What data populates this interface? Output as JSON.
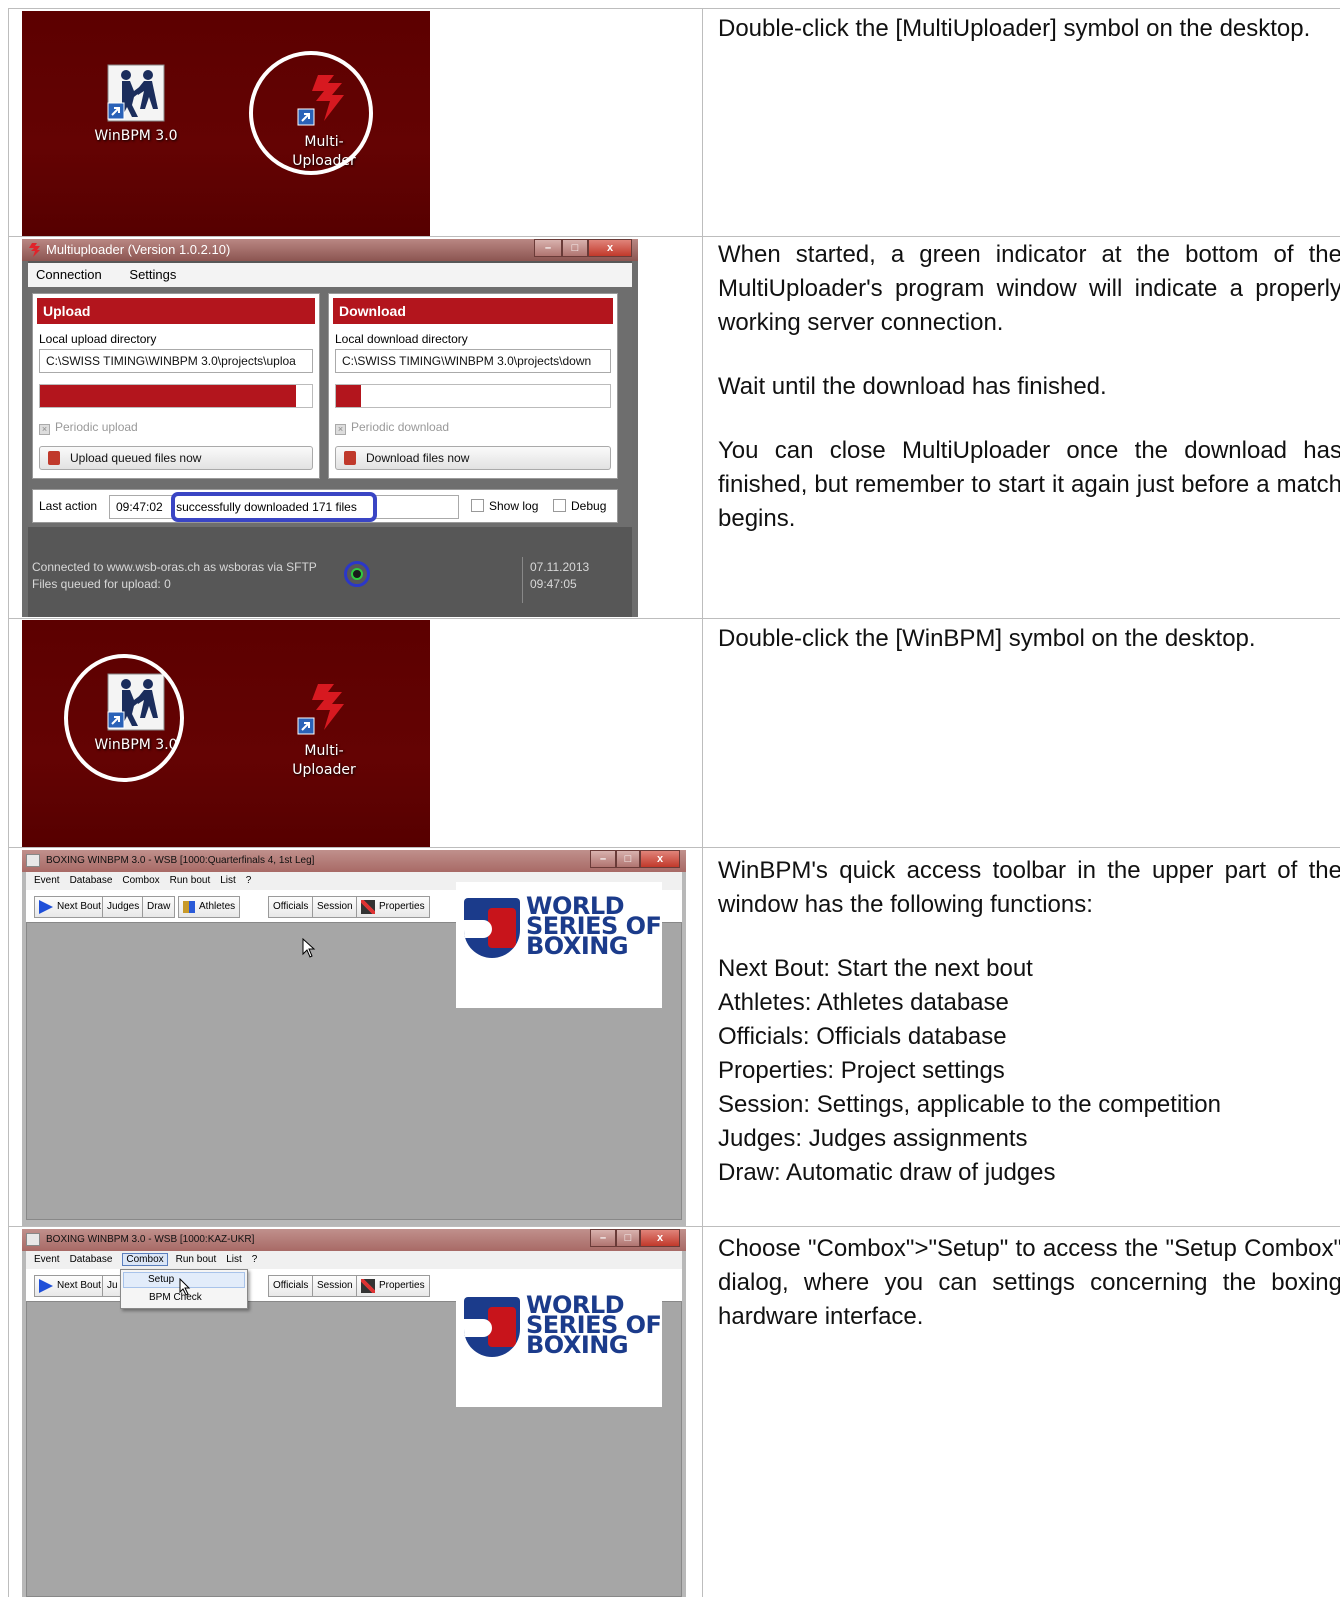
{
  "rows": [
    {
      "text": [
        "Double-click the [MultiUploader] symbol on the desktop."
      ]
    },
    {
      "text": [
        "When started, a green indicator at the bottom of the MultiUploader's program window will indicate a properly working server connection.",
        "Wait until the download has finished.",
        "You can close MultiUploader once the download has finished, but remember to start it again just before a match begins."
      ]
    },
    {
      "text": [
        "Double-click the [WinBPM] symbol on the desktop."
      ]
    },
    {
      "text": [
        "WinBPM's quick access toolbar in the upper part of the window has the following functions:"
      ],
      "functions": [
        "Next Bout: Start the next bout",
        "Athletes: Athletes database",
        "Officials: Officials database",
        "Properties: Project settings",
        "Session: Settings, applicable to the competition",
        "Judges: Judges assignments",
        "Draw: Automatic draw of judges"
      ]
    },
    {
      "text": [
        "Choose \"Combox\">\"Setup\" to access the \"Setup Combox\" dialog, where you can settings concerning the boxing hardware interface."
      ]
    }
  ],
  "desktop": {
    "winbpm_label": "WinBPM 3.0",
    "uploader_label_1": "Multi-",
    "uploader_label_2": "Uploader",
    "bg_color": "#5c0000"
  },
  "multiuploader": {
    "title": "Multiuploader (Version 1.0.2.10)",
    "menu": [
      "Connection",
      "Settings"
    ],
    "upload": {
      "header": "Upload",
      "dir_label": "Local upload directory",
      "dir_value": "C:\\SWISS TIMING\\WINBPM 3.0\\projects\\uploa",
      "progress": 0.94,
      "periodic": "Periodic upload",
      "button": "Upload queued files now"
    },
    "download": {
      "header": "Download",
      "dir_label": "Local download directory",
      "dir_value": "C:\\SWISS TIMING\\WINBPM 3.0\\projects\\down",
      "progress": 0.09,
      "periodic": "Periodic download",
      "button": "Download files now"
    },
    "last_action_label": "Last action",
    "last_action_time": "09:47:02",
    "last_action_text": "successfully downloaded 171 files",
    "show_log": "Show log",
    "debug": "Debug",
    "status_line1": "Connected to www.wsb-oras.ch as wsboras via SFTP",
    "status_line2": "Files queued for upload: 0",
    "date": "07.11.2013",
    "time": "09:47:05",
    "accent": "#b3151d",
    "indicator_color": "#2ecc40"
  },
  "winbpm1": {
    "title": "BOXING WINBPM 3.0 - WSB [1000:Quarterfinals 4, 1st Leg]",
    "menu": [
      "Event",
      "Database",
      "Combox",
      "Run bout",
      "List",
      "?"
    ],
    "toolbar": [
      "Next Bout",
      "Judges",
      "Draw",
      "Athletes",
      "Officials",
      "Session",
      "Properties"
    ]
  },
  "winbpm2": {
    "title": "BOXING WINBPM 3.0 - WSB [1000:KAZ-UKR]",
    "menu": [
      "Event",
      "Database",
      "Combox",
      "Run bout",
      "List",
      "?"
    ],
    "toolbar": [
      "Next Bout",
      "Ju",
      "Officials",
      "Session",
      "Properties"
    ],
    "dropdown": [
      "Setup",
      "BPM Check"
    ]
  },
  "wsb_logo": [
    "WORLD",
    "SERIES OF",
    "BOXING"
  ]
}
